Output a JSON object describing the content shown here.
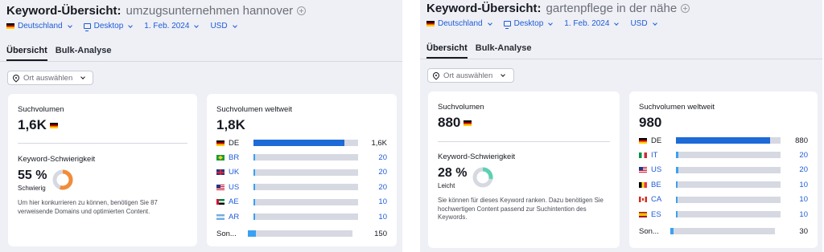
{
  "panels": [
    {
      "title": "Keyword-Übersicht:",
      "keyword": "umzugsunternehmen hannover",
      "filters": {
        "database": "Deutschland",
        "device": "Desktop",
        "date": "1. Feb. 2024",
        "currency": "USD"
      },
      "tabs": [
        "Übersicht",
        "Bulk-Analyse"
      ],
      "location_button": "Ort auswählen",
      "volume": {
        "label": "Suchvolumen",
        "value": "1,6K",
        "flag": "de"
      },
      "difficulty": {
        "label": "Keyword-Schwierigkeit",
        "percent": "55 %",
        "level": "Schwierig",
        "gauge_fraction": 0.55,
        "gauge_color": "#f28c3a",
        "description": "Um hier konkurrieren zu können, benötigen Sie 87 verweisende Domains und optimierten Content."
      },
      "global": {
        "label": "Suchvolumen weltweit",
        "value": "1,8K",
        "rows": [
          {
            "code": "DE",
            "flag": "de",
            "value": "1,6K",
            "fraction": 0.87,
            "primary": true
          },
          {
            "code": "BR",
            "flag": "br",
            "value": "20",
            "fraction": 0.015,
            "primary": false
          },
          {
            "code": "UK",
            "flag": "uk",
            "value": "20",
            "fraction": 0.015,
            "primary": false
          },
          {
            "code": "US",
            "flag": "us",
            "value": "20",
            "fraction": 0.015,
            "primary": false
          },
          {
            "code": "AE",
            "flag": "ae",
            "value": "10",
            "fraction": 0.01,
            "primary": false
          },
          {
            "code": "AR",
            "flag": "ar",
            "value": "10",
            "fraction": 0.01,
            "primary": false
          }
        ],
        "others": {
          "label": "Son...",
          "value": "150",
          "fraction": 0.08
        }
      }
    },
    {
      "title": "Keyword-Übersicht:",
      "keyword": "gartenpflege in der nähe",
      "filters": {
        "database": "Deutschland",
        "device": "Desktop",
        "date": "1. Feb. 2024",
        "currency": "USD"
      },
      "tabs": [
        "Übersicht",
        "Bulk-Analyse"
      ],
      "location_button": "Ort auswählen",
      "volume": {
        "label": "Suchvolumen",
        "value": "880",
        "flag": "de"
      },
      "difficulty": {
        "label": "Keyword-Schwierigkeit",
        "percent": "28 %",
        "level": "Leicht",
        "gauge_fraction": 0.28,
        "gauge_color": "#5cd1b2",
        "description": "Sie können für dieses Keyword ranken. Dazu benötigen Sie hochwertigen Content passend zur Suchintention des Keywords."
      },
      "global": {
        "label": "Suchvolumen weltweit",
        "value": "980",
        "rows": [
          {
            "code": "DE",
            "flag": "de",
            "value": "880",
            "fraction": 0.9,
            "primary": true
          },
          {
            "code": "IT",
            "flag": "it",
            "value": "20",
            "fraction": 0.02,
            "primary": false
          },
          {
            "code": "US",
            "flag": "us",
            "value": "20",
            "fraction": 0.02,
            "primary": false
          },
          {
            "code": "BE",
            "flag": "be",
            "value": "10",
            "fraction": 0.012,
            "primary": false
          },
          {
            "code": "CA",
            "flag": "ca",
            "value": "10",
            "fraction": 0.012,
            "primary": false
          },
          {
            "code": "ES",
            "flag": "es",
            "value": "10",
            "fraction": 0.012,
            "primary": false
          }
        ],
        "others": {
          "label": "Son...",
          "value": "30",
          "fraction": 0.03
        }
      }
    }
  ]
}
